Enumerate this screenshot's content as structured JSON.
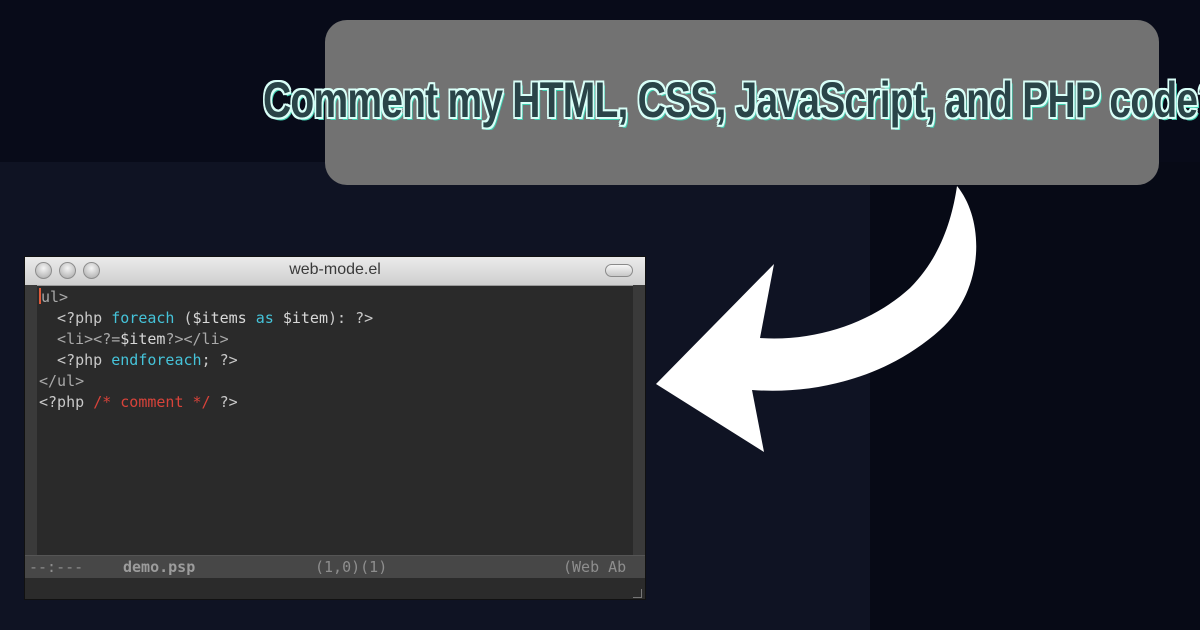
{
  "banner": {
    "text": "Comment my HTML, CSS, JavaScript, and PHP code?"
  },
  "window": {
    "title": "web-mode.el"
  },
  "code_lines": [
    [
      {
        "t": "<ul>",
        "c": "k-tag"
      }
    ],
    [
      {
        "t": "  <?php ",
        "c": "k-php"
      },
      {
        "t": "foreach",
        "c": "k-kw"
      },
      {
        "t": " (",
        "c": "k-php"
      },
      {
        "t": "$items",
        "c": "k-var"
      },
      {
        "t": " as ",
        "c": "k-kw"
      },
      {
        "t": "$item",
        "c": "k-var"
      },
      {
        "t": "): ?>",
        "c": "k-php"
      }
    ],
    [
      {
        "t": "  <li><?=",
        "c": "k-tag"
      },
      {
        "t": "$item",
        "c": "k-var"
      },
      {
        "t": "?></li>",
        "c": "k-tag"
      }
    ],
    [
      {
        "t": "  <?php ",
        "c": "k-php"
      },
      {
        "t": "endforeach",
        "c": "k-kw"
      },
      {
        "t": "; ?>",
        "c": "k-php"
      }
    ],
    [
      {
        "t": "</ul>",
        "c": "k-tag"
      }
    ],
    [
      {
        "t": "<?php ",
        "c": "k-php"
      },
      {
        "t": "/* comment */",
        "c": "k-com"
      },
      {
        "t": " ?>",
        "c": "k-php"
      }
    ]
  ],
  "modeline": {
    "status": "--:---",
    "buffer_name": "demo.psp",
    "position": "(1,0)(1)",
    "mode": "(Web Ab"
  },
  "colors": {
    "bubble_bg": "#727272",
    "banner_text": "#2a4448",
    "banner_outline": "#d9fff8",
    "keyword": "#45c3d9",
    "comment": "#d8433a",
    "cursor": "#e05a3a"
  },
  "icons": [
    "close-button-icon",
    "minimize-button-icon",
    "zoom-button-icon",
    "toolbar-toggle-icon",
    "curved-arrow-icon",
    "resize-grip-icon"
  ]
}
